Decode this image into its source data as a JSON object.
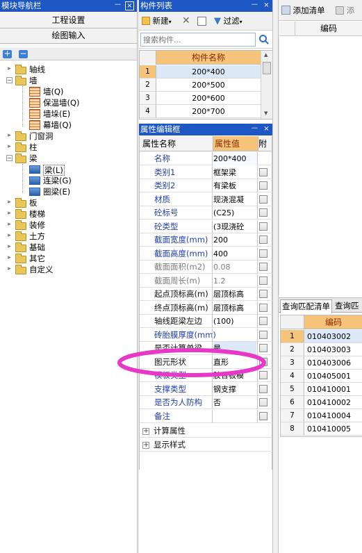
{
  "nav": {
    "title": "模块导航栏",
    "pin": "ᅳ",
    "close": "×",
    "btn_project_settings": "工程设置",
    "btn_drawing_input": "绘图输入",
    "tree": [
      {
        "label": "轴线",
        "level": 0,
        "expanded": false
      },
      {
        "label": "墙",
        "level": 0,
        "expanded": true
      },
      {
        "label": "墙(Q)",
        "level": 1
      },
      {
        "label": "保温墙(Q)",
        "level": 1
      },
      {
        "label": "墙垛(E)",
        "level": 1
      },
      {
        "label": "幕墙(Q)",
        "level": 1
      },
      {
        "label": "门窗洞",
        "level": 0,
        "expanded": false
      },
      {
        "label": "柱",
        "level": 0,
        "expanded": false
      },
      {
        "label": "梁",
        "level": 0,
        "expanded": true
      },
      {
        "label": "梁(L)",
        "level": 1
      },
      {
        "label": "连梁(G)",
        "level": 1
      },
      {
        "label": "圈梁(E)",
        "level": 1
      },
      {
        "label": "板",
        "level": 0,
        "expanded": false
      },
      {
        "label": "楼梯",
        "level": 0,
        "expanded": false
      },
      {
        "label": "装修",
        "level": 0,
        "expanded": false
      },
      {
        "label": "土方",
        "level": 0,
        "expanded": false
      },
      {
        "label": "基础",
        "level": 0,
        "expanded": false
      },
      {
        "label": "其它",
        "level": 0,
        "expanded": false
      },
      {
        "label": "自定义",
        "level": 0,
        "expanded": false
      }
    ]
  },
  "component_list": {
    "title": "构件列表",
    "new_label": "新建",
    "filter_label": "过滤",
    "search_placeholder": "搜索构件...",
    "header": "构件名称",
    "rows": [
      {
        "n": "1",
        "name": "200*400"
      },
      {
        "n": "2",
        "name": "200*500"
      },
      {
        "n": "3",
        "name": "200*600"
      },
      {
        "n": "4",
        "name": "200*700"
      }
    ]
  },
  "property_editor": {
    "title": "属性编辑框",
    "col_name": "属性名称",
    "col_value": "属性值",
    "col_attach": "附加",
    "rows": [
      {
        "name": "名称",
        "value": "200*400",
        "color": "blue",
        "checkbox": false
      },
      {
        "name": "类别1",
        "value": "框架梁",
        "color": "blue",
        "checkbox": true
      },
      {
        "name": "类别2",
        "value": "有梁板",
        "color": "blue",
        "checkbox": true
      },
      {
        "name": "材质",
        "value": "现浇混凝",
        "color": "blue",
        "checkbox": true
      },
      {
        "name": "砼标号",
        "value": "(C25)",
        "color": "blue",
        "checkbox": true
      },
      {
        "name": "砼类型",
        "value": "(3现浇砼",
        "color": "blue",
        "checkbox": true
      },
      {
        "name": "截面宽度(mm)",
        "value": "200",
        "color": "blue",
        "checkbox": true
      },
      {
        "name": "截面高度(mm)",
        "value": "400",
        "color": "blue",
        "checkbox": true
      },
      {
        "name": "截面面积(m2)",
        "value": "0.08",
        "color": "gray",
        "checkbox": true
      },
      {
        "name": "截面周长(m)",
        "value": "1.2",
        "color": "gray",
        "checkbox": true
      },
      {
        "name": "起点顶标高(m)",
        "value": "层顶标高",
        "color": "black",
        "checkbox": true
      },
      {
        "name": "终点顶标高(m)",
        "value": "层顶标高",
        "color": "black",
        "checkbox": true
      },
      {
        "name": "轴线距梁左边",
        "value": "(100)",
        "color": "black",
        "checkbox": true
      },
      {
        "name": "砖胎膜厚度(mm)",
        "value": "",
        "color": "blue",
        "checkbox": true
      },
      {
        "name": "是否计算单梁",
        "value": "是",
        "color": "black",
        "checkbox": true
      },
      {
        "name": "图元形状",
        "value": "直形",
        "color": "black",
        "checkbox": true
      },
      {
        "name": "模板类型",
        "value": "胶合板模",
        "color": "blue",
        "checkbox": true
      },
      {
        "name": "支撑类型",
        "value": "钢支撑",
        "color": "blue",
        "checkbox": true
      },
      {
        "name": "是否为人防构",
        "value": "否",
        "color": "blue",
        "checkbox": true
      },
      {
        "name": "备注",
        "value": "",
        "color": "blue",
        "checkbox": true
      }
    ],
    "groups": [
      {
        "name": "计算属性"
      },
      {
        "name": "显示样式"
      }
    ]
  },
  "right_panel": {
    "add_list_label": "添加清单",
    "add_quota_label": "添",
    "col_code": "编码",
    "tab_query_match": "查询匹配清单",
    "tab_query_match2": "查询匹",
    "match_header": "编码",
    "match_rows": [
      {
        "n": "1",
        "code": "010403002"
      },
      {
        "n": "2",
        "code": "010403003"
      },
      {
        "n": "3",
        "code": "010403006"
      },
      {
        "n": "4",
        "code": "010405001"
      },
      {
        "n": "5",
        "code": "010410001"
      },
      {
        "n": "6",
        "code": "010410002"
      },
      {
        "n": "7",
        "code": "010410004"
      },
      {
        "n": "8",
        "code": "010410005"
      }
    ]
  },
  "colors": {
    "titlebar": "#1d57c4",
    "header_orange": "#f5c47a",
    "highlight_ellipse": "#e838c8",
    "selected_row": "#dce8f8"
  }
}
